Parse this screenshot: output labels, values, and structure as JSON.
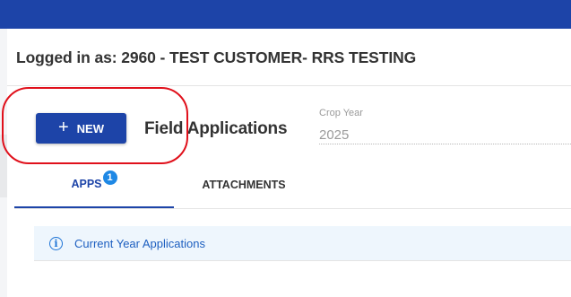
{
  "header": {
    "logged_in_text": "Logged in as: 2960 - TEST CUSTOMER- RRS TESTING"
  },
  "toolbar": {
    "new_button_icon": "plus-icon",
    "new_button_plus": "+",
    "new_button_label": "NEW",
    "page_title": "Field Applications"
  },
  "crop_year": {
    "label": "Crop Year",
    "value": "2025"
  },
  "tabs": [
    {
      "label": "APPS",
      "badge": "1",
      "active": true
    },
    {
      "label": "ATTACHMENTS",
      "active": false
    }
  ],
  "section": {
    "icon": "info-icon",
    "icon_glyph": "i",
    "title": "Current Year Applications"
  },
  "colors": {
    "brand_blue": "#1d44a8",
    "info_blue": "#1e74d6",
    "annotation_red": "#e0101b"
  }
}
